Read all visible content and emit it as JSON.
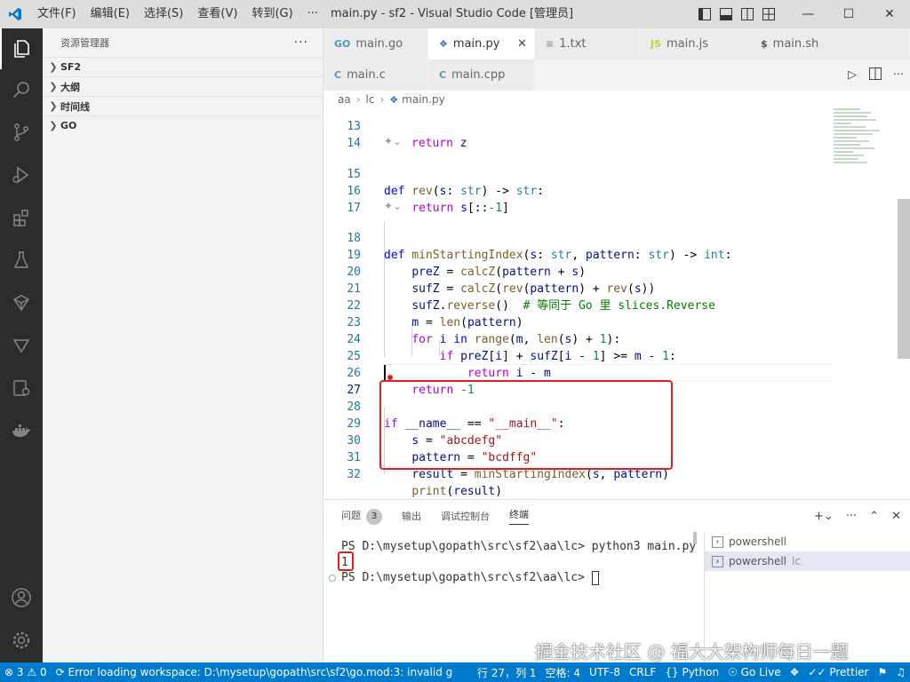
{
  "titlebar": {
    "menu": [
      "文件(F)",
      "编辑(E)",
      "选择(S)",
      "查看(V)",
      "转到(G)",
      "···"
    ],
    "title": "main.py - sf2 - Visual Studio Code [管理员]"
  },
  "sidebar": {
    "title": "资源管理器",
    "more": "···",
    "sections": [
      "SF2",
      "大纲",
      "时间线",
      "GO"
    ]
  },
  "tabs": [
    {
      "icon": "GO",
      "label": "main.go",
      "icon_color": "#519aba"
    },
    {
      "icon": "py",
      "label": "main.py",
      "icon_color": "#3572a5",
      "active": true
    },
    {
      "icon": "≡",
      "label": "1.txt",
      "icon_color": "#999999"
    },
    {
      "icon": "JS",
      "label": "main.js",
      "icon_color": "#cbcb41"
    },
    {
      "icon": "$",
      "label": "main.sh",
      "icon_color": "#4d5a5e"
    },
    {
      "icon": "C",
      "label": "main.c",
      "icon_color": "#519aba"
    },
    {
      "icon": "C",
      "label": "main.cpp",
      "icon_color": "#519aba"
    }
  ],
  "breadcrumb": [
    "aa",
    "lc",
    "main.py"
  ],
  "code": {
    "lines": [
      {
        "n": "13",
        "text": "    return z"
      },
      {
        "n": "14",
        "text": ""
      },
      {
        "n": "15",
        "text": "def rev(s: str) -> str:"
      },
      {
        "n": "16",
        "text": "    return s[::-1]"
      },
      {
        "n": "17",
        "text": ""
      },
      {
        "n": "18",
        "text": "def minStartingIndex(s: str, pattern: str) -> int:"
      },
      {
        "n": "19",
        "text": "    preZ = calcZ(pattern + s)"
      },
      {
        "n": "20",
        "text": "    sufZ = calcZ(rev(pattern) + rev(s))"
      },
      {
        "n": "21",
        "text": "    sufZ.reverse()  # 等同于 Go 里 slices.Reverse"
      },
      {
        "n": "22",
        "text": "    m = len(pattern)"
      },
      {
        "n": "23",
        "text": "    for i in range(m, len(s) + 1):"
      },
      {
        "n": "24",
        "text": "        if preZ[i] + sufZ[i - 1] >= m - 1:"
      },
      {
        "n": "25",
        "text": "            return i - m"
      },
      {
        "n": "26",
        "text": "    return -1"
      },
      {
        "n": "27",
        "text": ""
      },
      {
        "n": "28",
        "text": "if __name__ == \"__main__\":"
      },
      {
        "n": "29",
        "text": "    s = \"abcdefg\""
      },
      {
        "n": "30",
        "text": "    pattern = \"bcdffg\""
      },
      {
        "n": "31",
        "text": "    result = minStartingIndex(s, pattern)"
      },
      {
        "n": "32",
        "text": "    print(result)"
      }
    ],
    "codelens_icon": "sparkle-icon"
  },
  "panel": {
    "tabs": [
      "问题",
      "输出",
      "调试控制台",
      "终端"
    ],
    "problems_count": "3",
    "active_tab": "终端",
    "terminal_lines": [
      "PS D:\\mysetup\\gopath\\src\\sf2\\aa\\lc> python3 main.py",
      "1",
      "PS D:\\mysetup\\gopath\\src\\sf2\\aa\\lc> "
    ],
    "terminals": [
      {
        "label": "powershell",
        "sub": ""
      },
      {
        "label": "powershell",
        "sub": "lc",
        "selected": true
      }
    ]
  },
  "statusbar": {
    "errors": "3",
    "warnings": "0",
    "message": "Error loading workspace: D:\\mysetup\\gopath\\src\\sf2\\go.mod:3: invalid g",
    "position": "行 27，列 1",
    "spaces": "空格: 4",
    "encoding": "UTF-8",
    "eol": "CRLF",
    "language": "Python",
    "golive": "Go Live",
    "prettier": "Prettier",
    "color_bg": "#007acc"
  },
  "watermark": "掘金技术社区 @ 福大大架构师每日一题"
}
